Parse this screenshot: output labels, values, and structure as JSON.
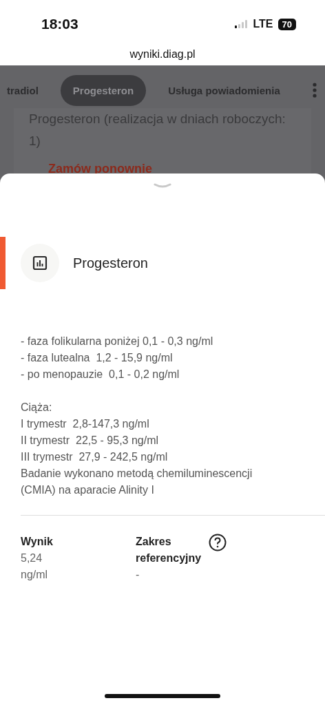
{
  "status_bar": {
    "time": "18:03",
    "network": "LTE",
    "battery": "70"
  },
  "url": "wyniki.diag.pl",
  "tabs": [
    {
      "label": "tradiol",
      "selected": false
    },
    {
      "label": "Progesteron",
      "selected": true
    },
    {
      "label": "Usługa powiadomienia",
      "selected": false
    }
  ],
  "background_content": {
    "text": "Progesteron (realizacja w dniach roboczych: 1)",
    "link": "Zamów ponownie"
  },
  "sheet": {
    "title": "Progesteron",
    "description": [
      "- faza folikularna poniżej 0,1 - 0,3 ng/ml\n- faza lutealna  1,2 - 15,9 ng/ml\n- po menopauzie  0,1 - 0,2 ng/ml",
      "Ciąża:\nI trymestr  2,8-147,3 ng/ml\nII trymestr  22,5 - 95,3 ng/ml\nIII trymestr  27,9 - 242,5 ng/ml\nBadanie wykonano metodą chemiluminescencji\n(CMIA) na aparacie Alinity I"
    ],
    "result": {
      "label": "Wynik",
      "value": "5,24",
      "unit": "ng/ml"
    },
    "reference": {
      "label": "Zakres referencyjny",
      "value": "-"
    }
  }
}
